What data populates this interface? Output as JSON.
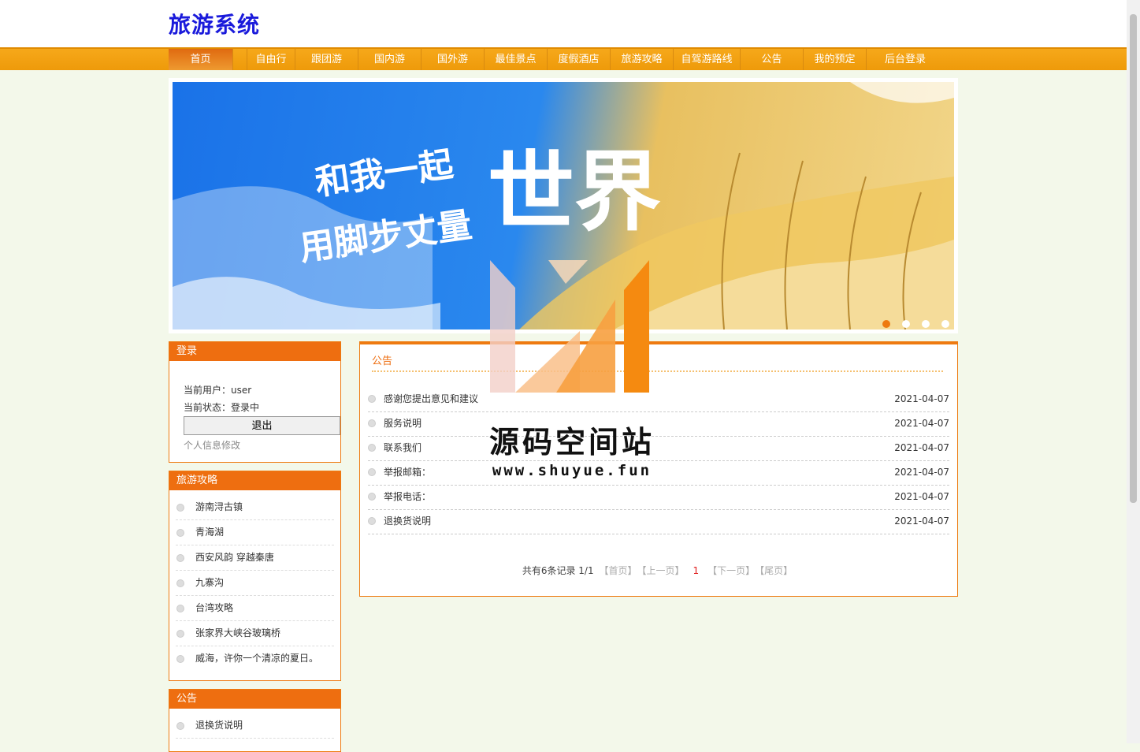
{
  "site": {
    "title": "旅游系统"
  },
  "nav": [
    {
      "label": "首页"
    },
    {
      "label": "自由行"
    },
    {
      "label": "跟团游"
    },
    {
      "label": "国内游"
    },
    {
      "label": "国外游"
    },
    {
      "label": "最佳景点"
    },
    {
      "label": "度假酒店"
    },
    {
      "label": "旅游攻略"
    },
    {
      "label": "自驾游路线"
    },
    {
      "label": "公告"
    },
    {
      "label": "我的预定"
    },
    {
      "label": "后台登录"
    }
  ],
  "banner": {
    "text_line1": "和我一起",
    "text_line2": "用脚步丈量",
    "text_big": "世界"
  },
  "login": {
    "title": "登录",
    "user_label": "当前用户：",
    "user_value": "user",
    "status_label": "当前状态：",
    "status_value": "登录中",
    "logout_label": "退出",
    "profile_link": "个人信息修改"
  },
  "guides": {
    "title": "旅游攻略",
    "items": [
      {
        "label": "游南浔古镇"
      },
      {
        "label": "青海湖"
      },
      {
        "label": "西安风韵 穿越秦唐"
      },
      {
        "label": "九寨沟"
      },
      {
        "label": "台湾攻略"
      },
      {
        "label": "张家界大峡谷玻璃桥"
      },
      {
        "label": "威海，许你一个清凉的夏日。"
      }
    ]
  },
  "side_notice": {
    "title": "公告",
    "items": [
      {
        "label": "退换货说明"
      }
    ]
  },
  "notice": {
    "title": "公告",
    "rows": [
      {
        "title": "感谢您提出意见和建议",
        "date": "2021-04-07"
      },
      {
        "title": "服务说明",
        "date": "2021-04-07"
      },
      {
        "title": "联系我们",
        "date": "2021-04-07"
      },
      {
        "title": "举报邮箱：",
        "date": "2021-04-07"
      },
      {
        "title": "举报电话：",
        "date": "2021-04-07"
      },
      {
        "title": "退换货说明",
        "date": "2021-04-07"
      }
    ],
    "pager": {
      "summary": "共有6条记录  1/1",
      "first": "【首页】",
      "prev": "【上一页】",
      "current": "1",
      "next": "【下一页】",
      "last": "【尾页】"
    }
  },
  "watermark": {
    "name": "源码空间站",
    "url": "www.shuyue.fun"
  }
}
